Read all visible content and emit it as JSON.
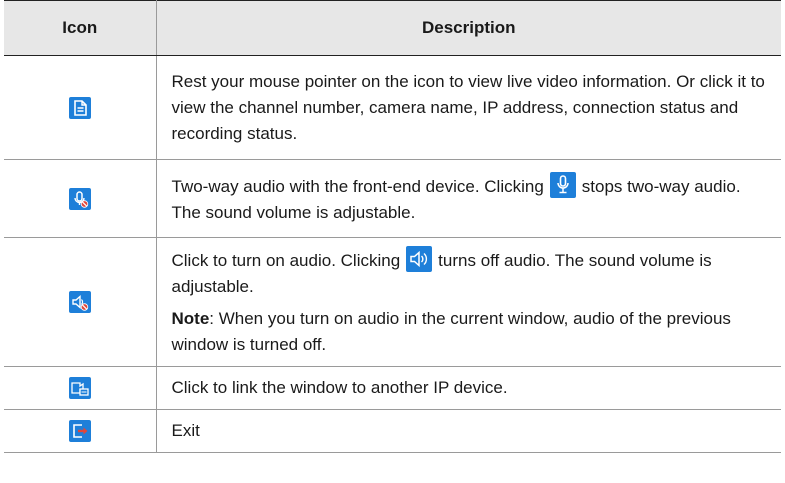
{
  "table": {
    "headers": {
      "icon": "Icon",
      "description": "Description"
    },
    "rows": [
      {
        "icon": "info-document-icon",
        "text": "Rest your mouse pointer on the icon to view live video information. Or click it to view the channel number, camera name, IP address, connection status and recording status."
      },
      {
        "icon": "two-way-audio-off-icon",
        "pre": "Two-way audio with the front-end device. Clicking",
        "inline_icon": "microphone-icon",
        "post": "stops two-way audio. The sound volume is adjustable."
      },
      {
        "icon": "audio-off-icon",
        "pre": "Click to turn on audio. Clicking",
        "inline_icon": "speaker-on-icon",
        "post": "turns off audio. The sound volume is adjustable.",
        "note_label": "Note",
        "note_text": ": When you turn on audio in the current window, audio of the previous window is turned off."
      },
      {
        "icon": "link-ip-device-icon",
        "text": "Click to link the window to another IP device."
      },
      {
        "icon": "exit-icon",
        "text": "Exit"
      }
    ]
  },
  "colors": {
    "icon_blue": "#1e7fd9",
    "exit_arrow": "#e0463a",
    "header_bg": "#e7e7e7"
  }
}
